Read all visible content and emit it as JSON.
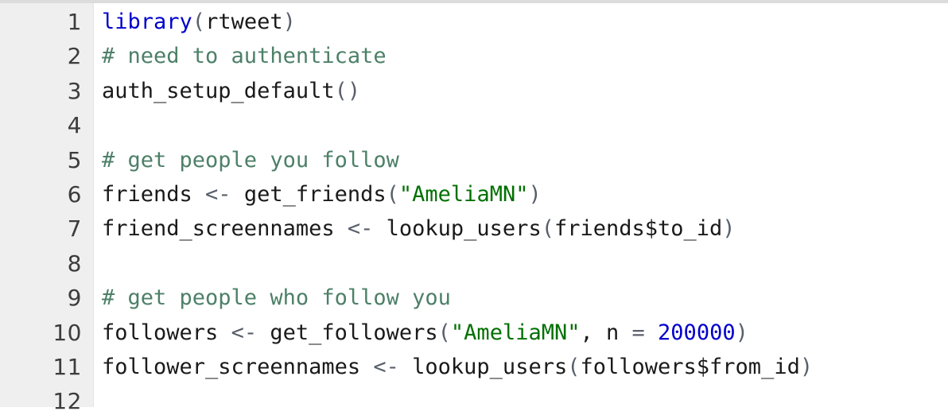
{
  "editor": {
    "language": "R",
    "total_lines": 12,
    "gutter_numbers": [
      "1",
      "2",
      "3",
      "4",
      "5",
      "6",
      "7",
      "8",
      "9",
      "10",
      "11",
      "12"
    ],
    "colors": {
      "background": "#ffffff",
      "gutter_background": "#efefef",
      "gutter_text": "#3c3c3c",
      "keyword": "#0000cc",
      "comment": "#4d8068",
      "string": "#007000",
      "number": "#0000cc",
      "operator": "#585f6b",
      "plain_text": "#1a1a1a"
    },
    "lines": [
      {
        "number": "1",
        "tokens": [
          {
            "text": "library",
            "type": "keyword"
          },
          {
            "text": "(",
            "type": "punct"
          },
          {
            "text": "rtweet",
            "type": "plain"
          },
          {
            "text": ")",
            "type": "punct"
          }
        ]
      },
      {
        "number": "2",
        "tokens": [
          {
            "text": "# need to authenticate",
            "type": "comment"
          }
        ]
      },
      {
        "number": "3",
        "tokens": [
          {
            "text": "auth_setup_default",
            "type": "plain"
          },
          {
            "text": "()",
            "type": "punct"
          }
        ]
      },
      {
        "number": "4",
        "tokens": []
      },
      {
        "number": "5",
        "tokens": [
          {
            "text": "# get people you follow",
            "type": "comment"
          }
        ]
      },
      {
        "number": "6",
        "tokens": [
          {
            "text": "friends ",
            "type": "plain"
          },
          {
            "text": "<-",
            "type": "operator"
          },
          {
            "text": " get_friends",
            "type": "plain"
          },
          {
            "text": "(",
            "type": "punct"
          },
          {
            "text": "\"AmeliaMN\"",
            "type": "string"
          },
          {
            "text": ")",
            "type": "punct"
          }
        ]
      },
      {
        "number": "7",
        "tokens": [
          {
            "text": "friend_screennames ",
            "type": "plain"
          },
          {
            "text": "<-",
            "type": "operator"
          },
          {
            "text": " lookup_users",
            "type": "plain"
          },
          {
            "text": "(",
            "type": "punct"
          },
          {
            "text": "friends$to_id",
            "type": "plain"
          },
          {
            "text": ")",
            "type": "punct"
          }
        ]
      },
      {
        "number": "8",
        "tokens": []
      },
      {
        "number": "9",
        "tokens": [
          {
            "text": "# get people who follow you",
            "type": "comment"
          }
        ]
      },
      {
        "number": "10",
        "tokens": [
          {
            "text": "followers ",
            "type": "plain"
          },
          {
            "text": "<-",
            "type": "operator"
          },
          {
            "text": " get_followers",
            "type": "plain"
          },
          {
            "text": "(",
            "type": "punct"
          },
          {
            "text": "\"AmeliaMN\"",
            "type": "string"
          },
          {
            "text": ", n ",
            "type": "plain"
          },
          {
            "text": "=",
            "type": "operator"
          },
          {
            "text": " ",
            "type": "plain"
          },
          {
            "text": "200000",
            "type": "number"
          },
          {
            "text": ")",
            "type": "punct"
          }
        ]
      },
      {
        "number": "11",
        "tokens": [
          {
            "text": "follower_screennames ",
            "type": "plain"
          },
          {
            "text": "<-",
            "type": "operator"
          },
          {
            "text": " lookup_users",
            "type": "plain"
          },
          {
            "text": "(",
            "type": "punct"
          },
          {
            "text": "followers$from_id",
            "type": "plain"
          },
          {
            "text": ")",
            "type": "punct"
          }
        ]
      },
      {
        "number": "12",
        "tokens": []
      }
    ]
  }
}
